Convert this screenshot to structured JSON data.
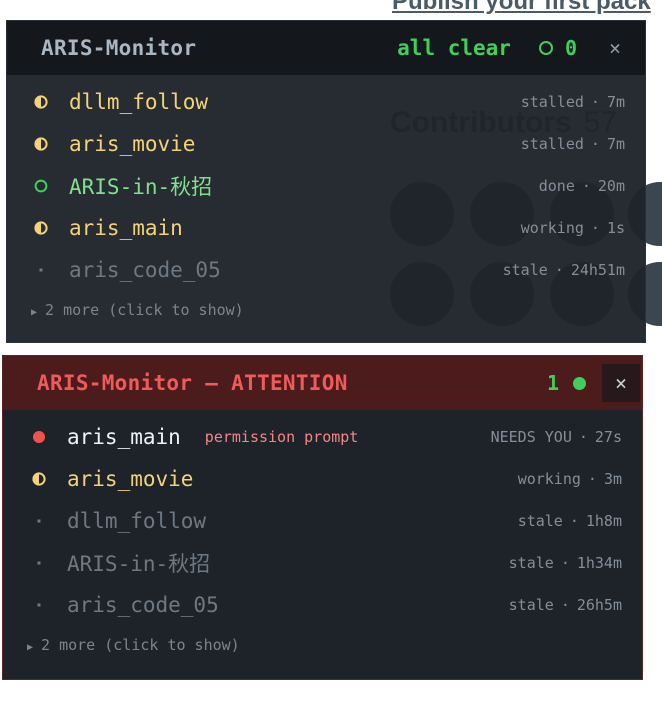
{
  "background_page": {
    "headline": "Publish your first pack",
    "contributors_label": "Contributors",
    "contributors_count": "57"
  },
  "panel_clear": {
    "title": "ARIS-Monitor",
    "status": "all clear",
    "count": "0",
    "close_label": "×",
    "sessions": [
      {
        "name": "dllm_follow",
        "state": "stalled",
        "sep": "·",
        "age": "7m",
        "icon": "half-circle-icon",
        "color": "#f3d37a"
      },
      {
        "name": "aris_movie",
        "state": "stalled",
        "sep": "·",
        "age": "7m",
        "icon": "half-circle-icon",
        "color": "#f3d37a"
      },
      {
        "name": "ARIS-in-秋招",
        "state": "done",
        "sep": "·",
        "age": "20m",
        "icon": "ring-icon",
        "color": "#3fcf5a"
      },
      {
        "name": "aris_main",
        "state": "working",
        "sep": "·",
        "age": "1s",
        "icon": "half-circle-icon",
        "color": "#f3d37a"
      },
      {
        "name": "aris_code_05",
        "state": "stale",
        "sep": "·",
        "age": "24h51m",
        "icon": "small-dot-icon",
        "color": "#6e7882"
      }
    ],
    "more_label": "2 more (click to show)"
  },
  "panel_attention": {
    "title": "ARIS-Monitor — ATTENTION",
    "count": "1",
    "close_label": "×",
    "sessions": [
      {
        "name": "aris_main",
        "tag": "permission prompt",
        "state": "NEEDS YOU",
        "sep": "·",
        "age": "27s",
        "icon": "red-dot-icon",
        "color": "#ef5350"
      },
      {
        "name": "aris_movie",
        "state": "working",
        "sep": "·",
        "age": "3m",
        "icon": "half-circle-icon",
        "color": "#f3d37a"
      },
      {
        "name": "dllm_follow",
        "state": "stale",
        "sep": "·",
        "age": "1h8m",
        "icon": "small-dot-icon",
        "color": "#6e7882"
      },
      {
        "name": "ARIS-in-秋招",
        "state": "stale",
        "sep": "·",
        "age": "1h34m",
        "icon": "small-dot-icon",
        "color": "#6e7882"
      },
      {
        "name": "aris_code_05",
        "state": "stale",
        "sep": "·",
        "age": "26h5m",
        "icon": "small-dot-icon",
        "color": "#6e7882"
      }
    ],
    "more_label": "2 more (click to show)"
  },
  "colors": {
    "green": "#3fcf5a",
    "yellow": "#f3d37a",
    "red": "#ef5350",
    "attention_header": "#4c1c1d"
  }
}
